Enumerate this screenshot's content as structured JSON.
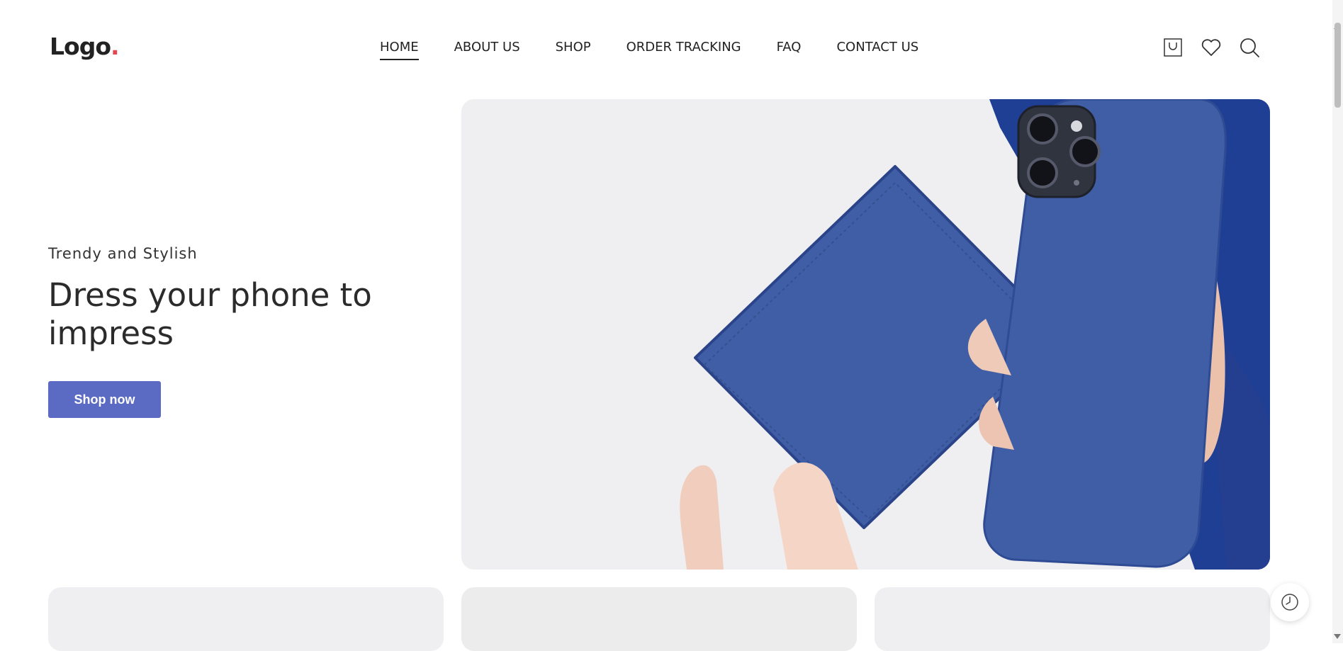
{
  "header": {
    "logo_text": "Logo",
    "logo_dot": ".",
    "nav": [
      {
        "label": "HOME",
        "active": true
      },
      {
        "label": "ABOUT US"
      },
      {
        "label": "SHOP"
      },
      {
        "label": "ORDER TRACKING"
      },
      {
        "label": "FAQ"
      },
      {
        "label": "CONTACT US"
      }
    ],
    "icons": [
      "cart-icon",
      "wishlist-heart-icon",
      "search-icon"
    ]
  },
  "hero": {
    "subtitle": "Trendy and Stylish",
    "headline": "Dress your phone to impress",
    "button_label": "Shop now"
  },
  "colors": {
    "accent": "#5b6ac2",
    "logo_dot": "#e5474f",
    "product_blue": "#3f5ea6",
    "text": "#222222"
  }
}
